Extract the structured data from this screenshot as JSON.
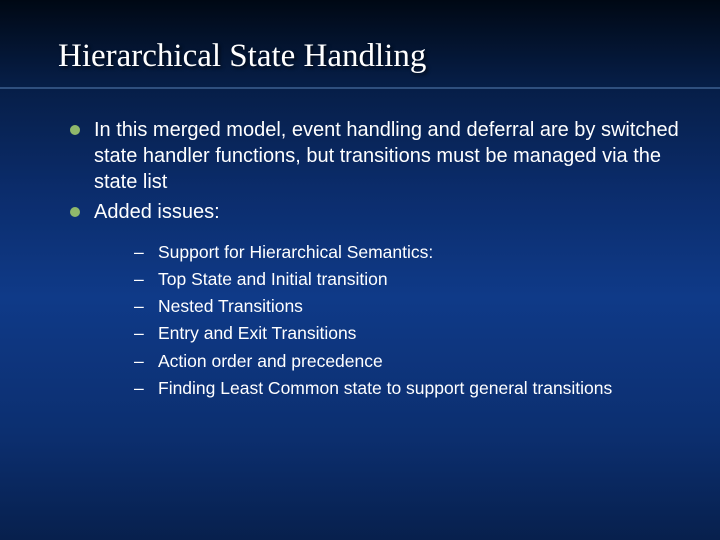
{
  "title": "Hierarchical State Handling",
  "bullets": {
    "b0": "In this merged model, event handling and deferral are by switched state handler functions, but transitions must be managed via the state list",
    "b1": "Added issues:"
  },
  "subs": {
    "s0": "Support for Hierarchical Semantics:",
    "s1": "Top State and Initial transition",
    "s2": "Nested Transitions",
    "s3": "Entry and Exit Transitions",
    "s4": "Action order and precedence",
    "s5": "Finding Least Common state to support general transitions"
  },
  "dash": "–"
}
